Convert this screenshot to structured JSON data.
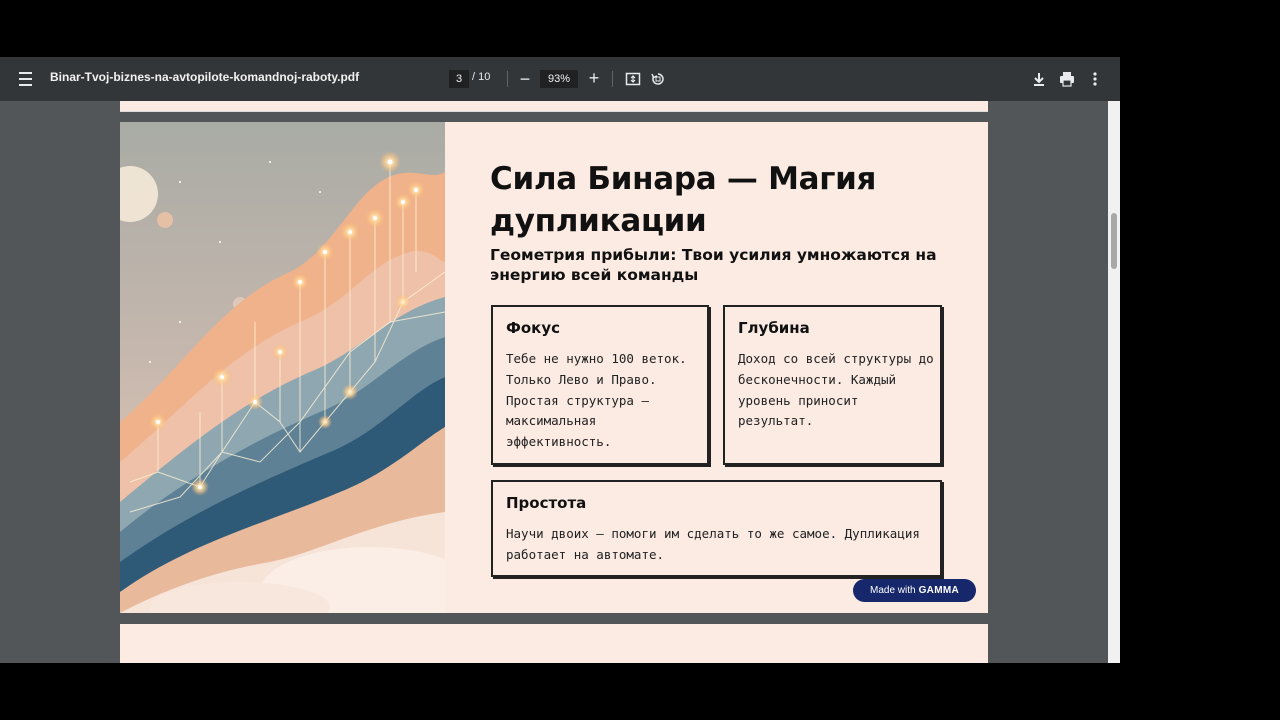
{
  "toolbar": {
    "file_name": "Binar-Tvoj-biznes-na-avtopilote-komandnoj-raboty.pdf",
    "current_page": "3",
    "total_pages": "/ 10",
    "zoom": "93%",
    "zoom_out_label": "−",
    "zoom_in_label": "+",
    "icons": [
      "menu-icon",
      "fit-page-icon",
      "rotate-icon",
      "download-icon",
      "print-icon",
      "more-vert-icon"
    ]
  },
  "slide": {
    "title": "Сила Бинара — Магия дупликации",
    "subtitle": "Геометрия прибыли: Твои усилия умножаются на энергию всей команды",
    "cards": [
      {
        "title": "Фокус",
        "body": "Тебе не нужно 100 веток. Только Лево и Право. Простая структура – максимальная эффективность."
      },
      {
        "title": "Глубина",
        "body": "Доход со всей структуры до бесконечности. Каждый уровень приносит результат."
      },
      {
        "title": "Простота",
        "body": "Научи двоих – помоги им сделать то же самое. Дупликация работает на автомате."
      }
    ],
    "badge_prefix": "Made with",
    "badge_brand": "GAMMA"
  },
  "colors": {
    "toolbar_bg": "#323639",
    "viewer_bg": "#525659",
    "slide_bg": "#fbebe3",
    "badge_bg": "#16286b"
  }
}
